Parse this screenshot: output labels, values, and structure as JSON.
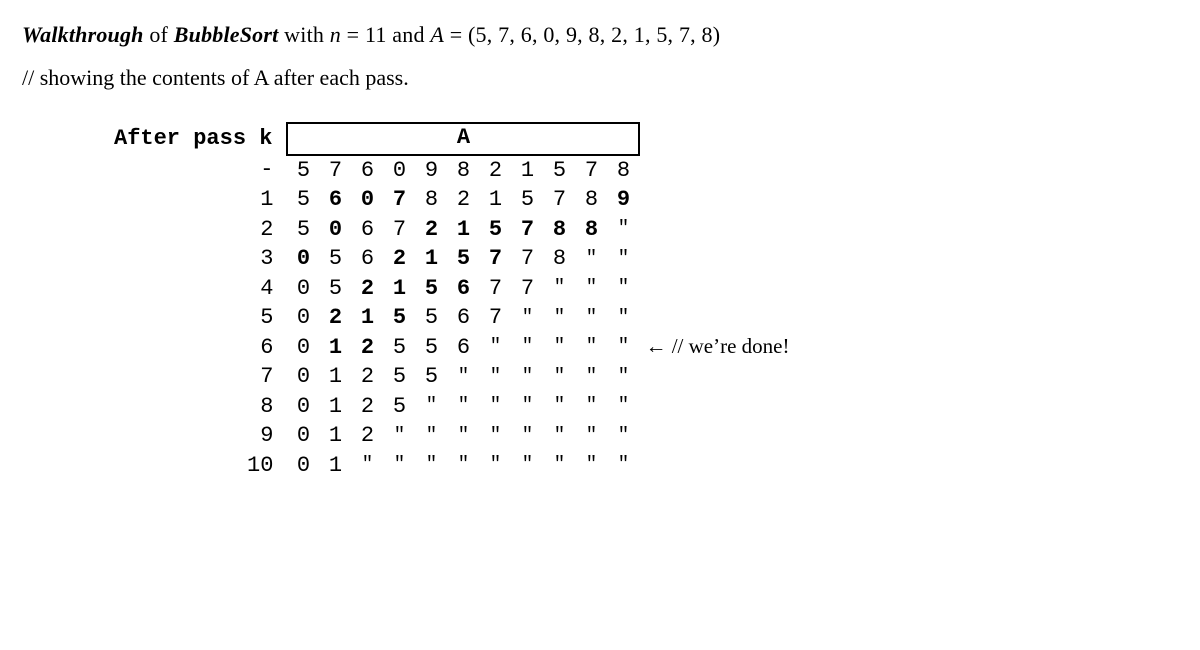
{
  "title": {
    "walkthrough": "Walkthrough",
    "of": " of ",
    "algo": "BubbleSort",
    "withn_prefix": " with ",
    "nvar": "n",
    "equals1": " = ",
    "nval": "11",
    "and": " and ",
    "Avar": "A",
    "equals2": " = ",
    "Aval": "(5, 7, 6, 0, 9, 8, 2, 1, 5, 7, 8)"
  },
  "comment": "// showing the contents of A after each pass.",
  "header_left": "After pass k",
  "header_a": "A",
  "ditto": "\"",
  "done_annot": "← // we’re done!",
  "rows": [
    {
      "k": "-",
      "cells": [
        "5",
        "7",
        "6",
        "0",
        "9",
        "8",
        "2",
        "1",
        "5",
        "7",
        "8"
      ],
      "locked": 0,
      "new": []
    },
    {
      "k": "1",
      "cells": [
        "5",
        "6",
        "0",
        "7",
        "8",
        "2",
        "1",
        "5",
        "7",
        "8",
        "9"
      ],
      "locked": 0,
      "new": [
        1,
        2,
        3,
        10
      ]
    },
    {
      "k": "2",
      "cells": [
        "5",
        "0",
        "6",
        "7",
        "2",
        "1",
        "5",
        "7",
        "8",
        "8"
      ],
      "locked": 1,
      "new": [
        1,
        4,
        5,
        6,
        7,
        8,
        9
      ]
    },
    {
      "k": "3",
      "cells": [
        "0",
        "5",
        "6",
        "2",
        "1",
        "5",
        "7",
        "7",
        "8"
      ],
      "locked": 2,
      "new": [
        0,
        3,
        4,
        5,
        6
      ]
    },
    {
      "k": "4",
      "cells": [
        "0",
        "5",
        "2",
        "1",
        "5",
        "6",
        "7",
        "7"
      ],
      "locked": 3,
      "new": [
        2,
        3,
        4,
        5
      ]
    },
    {
      "k": "5",
      "cells": [
        "0",
        "2",
        "1",
        "5",
        "5",
        "6",
        "7"
      ],
      "locked": 4,
      "new": [
        1,
        2,
        3
      ]
    },
    {
      "k": "6",
      "cells": [
        "0",
        "1",
        "2",
        "5",
        "5",
        "6"
      ],
      "locked": 5,
      "new": [
        1,
        2
      ],
      "annot": true
    },
    {
      "k": "7",
      "cells": [
        "0",
        "1",
        "2",
        "5",
        "5"
      ],
      "locked": 6,
      "new": []
    },
    {
      "k": "8",
      "cells": [
        "0",
        "1",
        "2",
        "5"
      ],
      "locked": 7,
      "new": []
    },
    {
      "k": "9",
      "cells": [
        "0",
        "1",
        "2"
      ],
      "locked": 8,
      "new": []
    },
    {
      "k": "10",
      "cells": [
        "0",
        "1"
      ],
      "locked": 9,
      "new": []
    }
  ]
}
